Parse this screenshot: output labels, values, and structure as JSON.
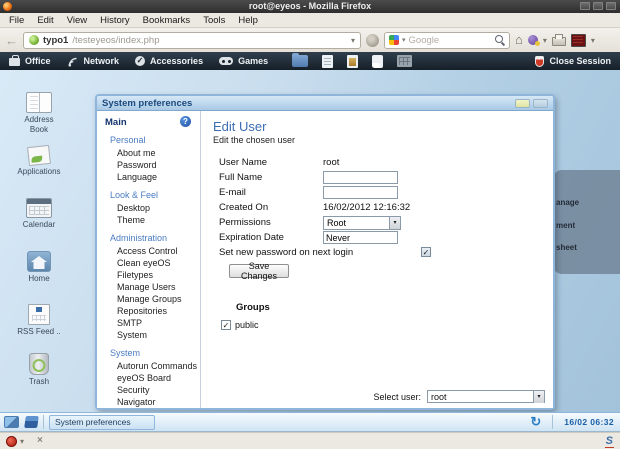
{
  "glyphs": {
    "back": "←",
    "chevron": "▾",
    "home": "⌂",
    "check": "✓",
    "close": "×",
    "sync": "↻",
    "help": "?"
  },
  "firefox": {
    "title": "root@eyeos - Mozilla Firefox",
    "menu": [
      "File",
      "Edit",
      "View",
      "History",
      "Bookmarks",
      "Tools",
      "Help"
    ],
    "urlbar": {
      "host": "typo1",
      "path": "/testeyeos/index.php"
    },
    "search": {
      "placeholder": "Google"
    }
  },
  "eyeos_bar": {
    "menus": [
      "Office",
      "Network",
      "Accessories",
      "Games"
    ],
    "close_session": "Close Session"
  },
  "desktop": {
    "icons": [
      {
        "label": "Address Book"
      },
      {
        "label": "Applications"
      },
      {
        "label": "Calendar"
      },
      {
        "label": "Home"
      },
      {
        "label": "RSS Feed .."
      },
      {
        "label": "Trash"
      }
    ],
    "side_panel_fragments": [
      "anage",
      "ment",
      "sheet"
    ]
  },
  "prefs": {
    "title": "System preferences",
    "sidebar": {
      "main": "Main",
      "sections": [
        {
          "title": "Personal",
          "items": [
            "About me",
            "Password",
            "Language"
          ]
        },
        {
          "title": "Look & Feel",
          "items": [
            "Desktop",
            "Theme"
          ]
        },
        {
          "title": "Administration",
          "items": [
            "Access Control",
            "Clean eyeOS",
            "Filetypes",
            "Manage Users",
            "Manage Groups",
            "Repositories",
            "SMTP",
            "System"
          ]
        },
        {
          "title": "System",
          "items": [
            "Autorun Commands",
            "eyeOS Board",
            "Security",
            "Navigator"
          ]
        }
      ]
    },
    "content": {
      "heading": "Edit User",
      "subheading": "Edit the chosen user",
      "rows": [
        {
          "label": "User Name",
          "value": "root"
        },
        {
          "label": "Full Name",
          "value": ""
        },
        {
          "label": "E-mail",
          "value": ""
        },
        {
          "label": "Created On",
          "value": "16/02/2012 12:16:32"
        },
        {
          "label": "Permissions",
          "value": "Root"
        },
        {
          "label": "Expiration Date",
          "value": "Never"
        },
        {
          "label": "Set new password on next login"
        }
      ],
      "save_button": "Save Changes",
      "groups_title": "Groups",
      "groups": [
        {
          "label": "public",
          "checked": true
        }
      ],
      "select_user_label": "Select user:",
      "select_user_value": "root"
    }
  },
  "taskbar": {
    "task": "System preferences",
    "clock": "16/02 06:32"
  },
  "statusbar": {
    "s_logo": "S"
  }
}
